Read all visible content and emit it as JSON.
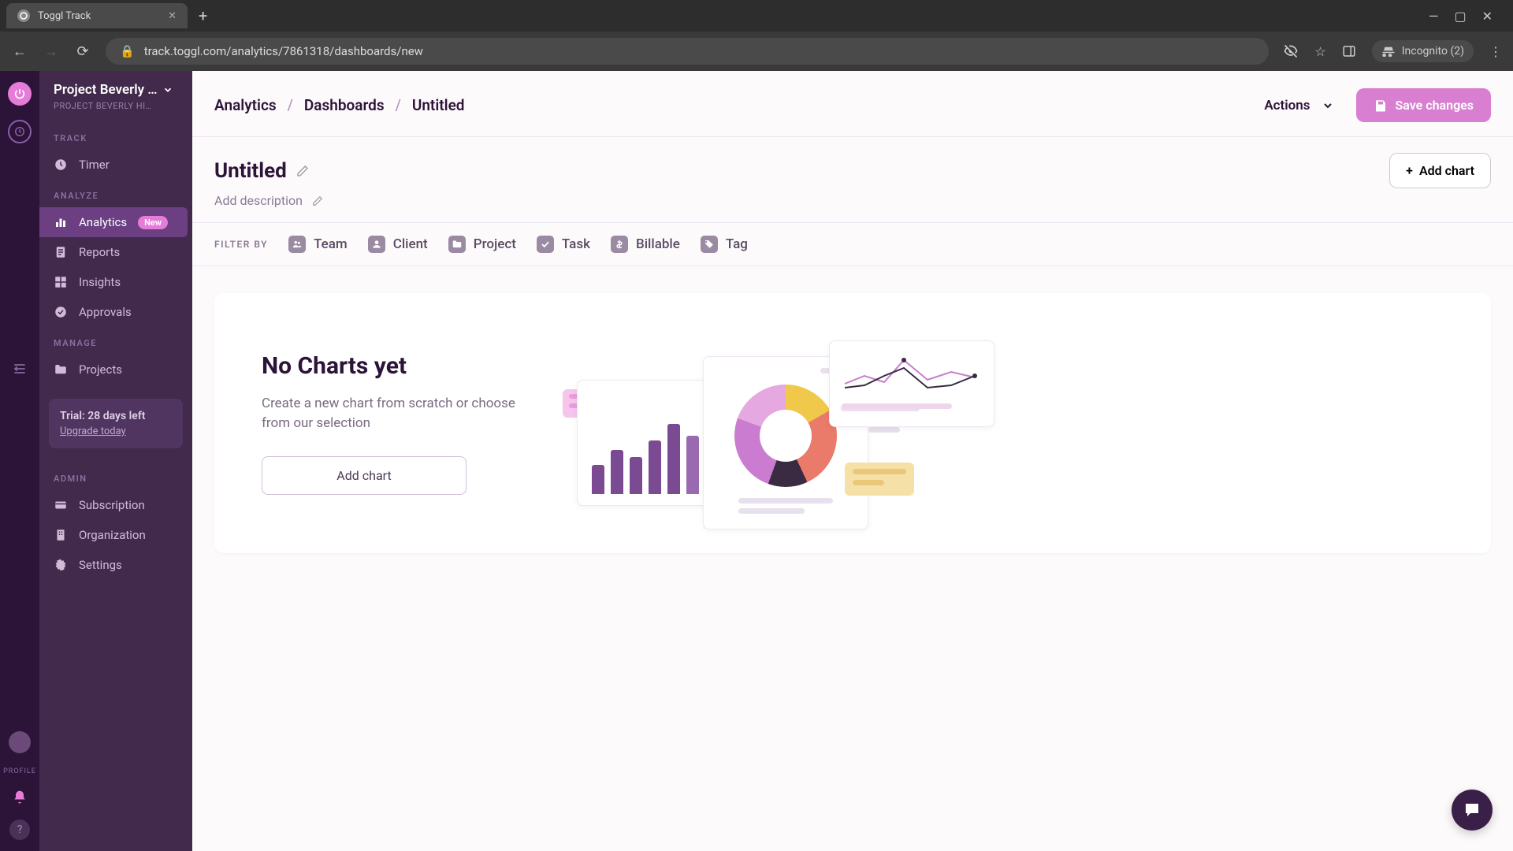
{
  "browser": {
    "tab_title": "Toggl Track",
    "url": "track.toggl.com/analytics/7861318/dashboards/new",
    "incognito_label": "Incognito (2)"
  },
  "workspace": {
    "name": "Project Beverly …",
    "sub": "PROJECT BEVERLY HI…"
  },
  "sidebar": {
    "sections": {
      "track": "TRACK",
      "analyze": "ANALYZE",
      "manage": "MANAGE",
      "admin": "ADMIN"
    },
    "items": {
      "timer": "Timer",
      "analytics": "Analytics",
      "analytics_badge": "New",
      "reports": "Reports",
      "insights": "Insights",
      "approvals": "Approvals",
      "projects": "Projects",
      "subscription": "Subscription",
      "organization": "Organization",
      "settings": "Settings"
    },
    "trial": {
      "text": "Trial: 28 days left",
      "upgrade": "Upgrade today"
    },
    "profile_label": "PROFILE"
  },
  "breadcrumb": {
    "root": "Analytics",
    "mid": "Dashboards",
    "leaf": "Untitled"
  },
  "header": {
    "actions": "Actions",
    "save": "Save changes"
  },
  "page": {
    "title": "Untitled",
    "description_placeholder": "Add description",
    "add_chart": "Add chart"
  },
  "filters": {
    "label": "FILTER BY",
    "team": "Team",
    "client": "Client",
    "project": "Project",
    "task": "Task",
    "billable": "Billable",
    "tag": "Tag"
  },
  "empty": {
    "heading": "No Charts yet",
    "sub": "Create a new chart from scratch or choose from our selection",
    "button": "Add chart"
  }
}
